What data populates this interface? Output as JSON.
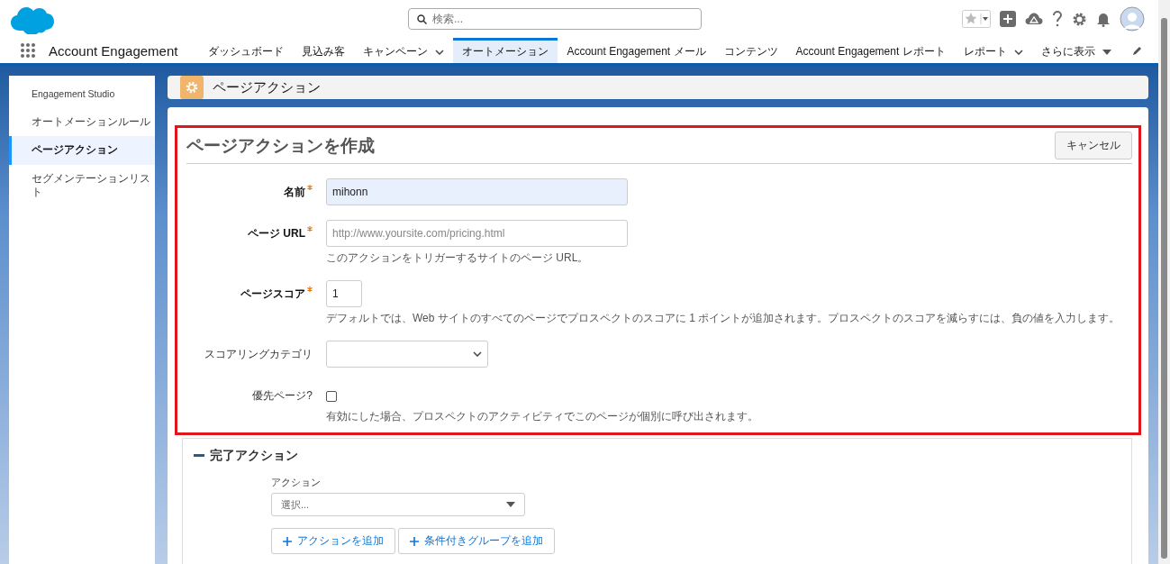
{
  "header": {
    "search": {
      "placeholder": "検索..."
    }
  },
  "nav": {
    "app_name": "Account Engagement",
    "items": [
      {
        "label": "ダッシュボード",
        "kind": "plain",
        "selected": false
      },
      {
        "label": "見込み客",
        "kind": "plain",
        "selected": false
      },
      {
        "label": "キャンペーン",
        "kind": "dropdown",
        "selected": false
      },
      {
        "label": "オートメーション",
        "kind": "plain",
        "selected": true
      },
      {
        "label": "Account Engagement メール",
        "kind": "plain",
        "selected": false
      },
      {
        "label": "コンテンツ",
        "kind": "plain",
        "selected": false
      },
      {
        "label": "Account Engagement レポート",
        "kind": "plain",
        "selected": false
      },
      {
        "label": "レポート",
        "kind": "dropdown",
        "selected": false
      },
      {
        "label": "さらに表示",
        "kind": "more",
        "selected": false
      }
    ]
  },
  "sidebar": {
    "items": [
      {
        "label": "Engagement Studio",
        "selected": false
      },
      {
        "label": "オートメーションルール",
        "selected": false
      },
      {
        "label": "ページアクション",
        "selected": true
      },
      {
        "label": "セグメンテーションリスト",
        "selected": false
      }
    ]
  },
  "page_header": {
    "title": "ページアクション"
  },
  "form": {
    "title": "ページアクションを作成",
    "cancel": "キャンセル",
    "fields": [
      {
        "kind": "text",
        "label": "名前",
        "required": true,
        "value": "mihonn",
        "autofilled": true
      },
      {
        "kind": "text",
        "label": "ページ URL",
        "required": true,
        "placeholder": "http://www.yoursite.com/pricing.html",
        "help": "このアクションをトリガーするサイトのページ URL。"
      },
      {
        "kind": "number",
        "label": "ページスコア",
        "required": true,
        "value": "1",
        "help": "デフォルトでは、Web サイトのすべてのページでプロスペクトのスコアに 1 ポイントが追加されます。プロスペクトのスコアを減らすには、負の値を入力します。"
      },
      {
        "kind": "select",
        "label": "スコアリングカテゴリ",
        "required": false
      },
      {
        "kind": "checkbox",
        "label": "優先ページ?",
        "required": false,
        "checked": false,
        "help": "有効にした場合、プロスペクトのアクティビティでこのページが個別に呼び出されます。"
      }
    ]
  },
  "completion": {
    "title": "完了アクション",
    "expanded": true,
    "action_label": "アクション",
    "action_placeholder": "選択...",
    "buttons": [
      "アクションを追加",
      "条件付きグループを追加"
    ]
  }
}
